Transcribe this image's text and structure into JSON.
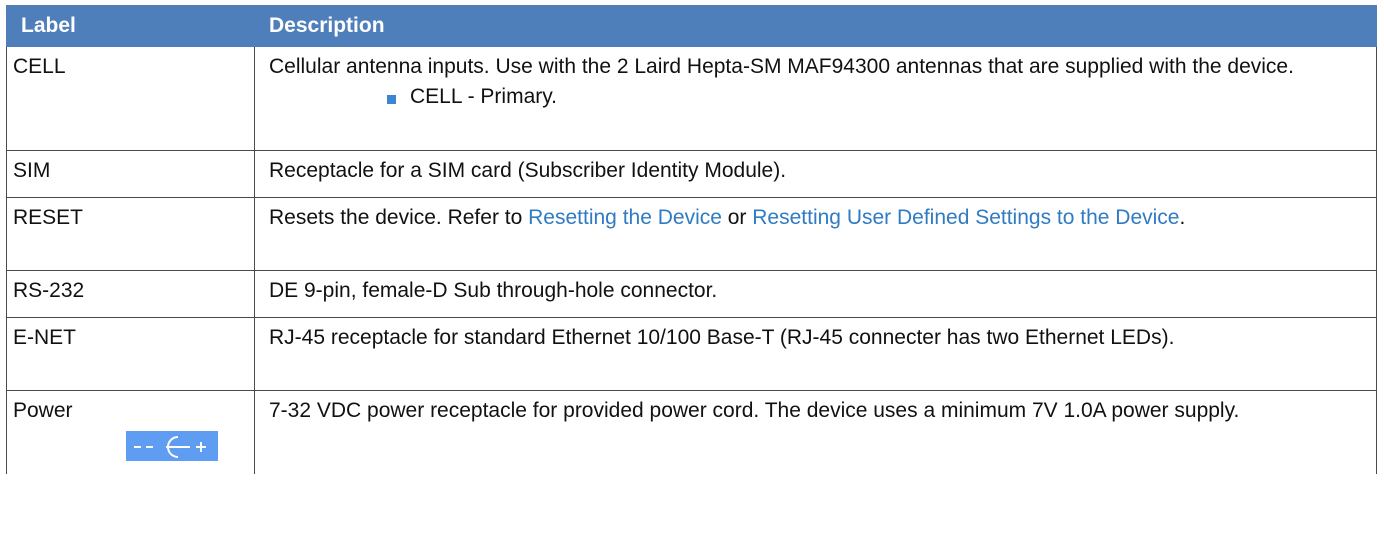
{
  "table": {
    "headers": {
      "label": "Label",
      "description": "Description"
    },
    "rows": {
      "cell": {
        "label": "CELL",
        "desc": "Cellular antenna inputs. Use with the 2 Laird Hepta-SM MAF94300 antennas that are supplied with the device.",
        "bullet": "CELL - Primary."
      },
      "sim": {
        "label": "SIM",
        "desc": "Receptacle for a SIM card (Subscriber Identity Module)."
      },
      "reset": {
        "label": "RESET",
        "desc_before": "Resets the device. Refer to ",
        "link1": "Resetting the Device",
        "desc_mid": " or ",
        "link2": "Resetting User Defined Settings to the Device",
        "desc_after": "."
      },
      "rs232": {
        "label": "RS-232",
        "desc": "DE 9-pin, female-D Sub through-hole connector."
      },
      "enet": {
        "label": "E-NET",
        "desc": "RJ-45 receptacle for standard Ethernet 10/100 Base-T (RJ-45 connecter has two Ethernet LEDs)."
      },
      "power": {
        "label": "Power",
        "icon": "power-polarity-icon",
        "icon_text": "- -G +",
        "desc": "7-32 VDC power receptacle for provided power cord. The device uses a minimum 7V 1.0A power supply."
      }
    }
  },
  "colors": {
    "header_bg": "#4e7fbb",
    "link": "#2f7bc4",
    "bullet": "#3a86d3",
    "icon_bg": "#5f9df2"
  }
}
